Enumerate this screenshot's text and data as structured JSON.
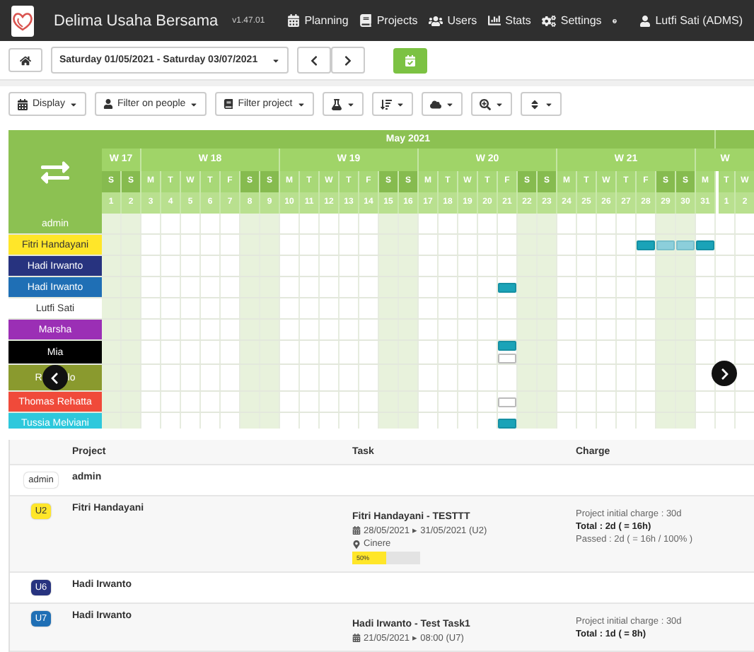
{
  "app": {
    "name": "Delima Usaha Bersama",
    "version": "v1.47.01",
    "menu": [
      {
        "kind": "planning",
        "label": "Planning"
      },
      {
        "kind": "projects",
        "label": "Projects"
      },
      {
        "kind": "users",
        "label": "Users"
      },
      {
        "kind": "stats",
        "label": "Stats"
      },
      {
        "kind": "settings",
        "label": "Settings"
      }
    ],
    "user": "Lutfi Sati (ADMS)"
  },
  "date_range": "Saturday 01/05/2021 - Saturday 03/07/2021",
  "filters": [
    {
      "kind": "display",
      "label": "Display"
    },
    {
      "kind": "people",
      "label": "Filter on people"
    },
    {
      "kind": "project",
      "label": "Filter project"
    },
    {
      "kind": "flask"
    },
    {
      "kind": "sort"
    },
    {
      "kind": "cloud"
    },
    {
      "kind": "zoom"
    },
    {
      "kind": "updown"
    }
  ],
  "months": [
    "May 2021"
  ],
  "weeks": [
    {
      "label": "W 17",
      "days": [
        {
          "n": "1",
          "d": "S",
          "weekend": true
        },
        {
          "n": "2",
          "d": "S",
          "weekend": true
        }
      ]
    },
    {
      "label": "W 18",
      "days": [
        {
          "n": "3",
          "d": "M",
          "weekend": false
        },
        {
          "n": "4",
          "d": "T",
          "weekend": false
        },
        {
          "n": "5",
          "d": "W",
          "weekend": false
        },
        {
          "n": "6",
          "d": "T",
          "weekend": false
        },
        {
          "n": "7",
          "d": "F",
          "weekend": false
        },
        {
          "n": "8",
          "d": "S",
          "weekend": true
        },
        {
          "n": "9",
          "d": "S",
          "weekend": true
        }
      ]
    },
    {
      "label": "W 19",
      "days": [
        {
          "n": "10",
          "d": "M",
          "weekend": false
        },
        {
          "n": "11",
          "d": "T",
          "weekend": false
        },
        {
          "n": "12",
          "d": "W",
          "weekend": false
        },
        {
          "n": "13",
          "d": "T",
          "weekend": false
        },
        {
          "n": "14",
          "d": "F",
          "weekend": false
        },
        {
          "n": "15",
          "d": "S",
          "weekend": true
        },
        {
          "n": "16",
          "d": "S",
          "weekend": true
        }
      ]
    },
    {
      "label": "W 20",
      "days": [
        {
          "n": "17",
          "d": "M",
          "weekend": false
        },
        {
          "n": "18",
          "d": "T",
          "weekend": false
        },
        {
          "n": "19",
          "d": "W",
          "weekend": false
        },
        {
          "n": "20",
          "d": "T",
          "weekend": false
        },
        {
          "n": "21",
          "d": "F",
          "weekend": false
        },
        {
          "n": "22",
          "d": "S",
          "weekend": true
        },
        {
          "n": "23",
          "d": "S",
          "weekend": true
        }
      ]
    },
    {
      "label": "W 21",
      "days": [
        {
          "n": "24",
          "d": "M",
          "weekend": false
        },
        {
          "n": "25",
          "d": "T",
          "weekend": false
        },
        {
          "n": "26",
          "d": "W",
          "weekend": false
        },
        {
          "n": "27",
          "d": "T",
          "weekend": false
        },
        {
          "n": "28",
          "d": "F",
          "weekend": false
        },
        {
          "n": "29",
          "d": "S",
          "weekend": true
        },
        {
          "n": "30",
          "d": "S",
          "weekend": true
        }
      ]
    },
    {
      "label": "W",
      "days": [
        {
          "n": "31",
          "d": "M",
          "weekend": false
        },
        {
          "n": "1",
          "d": "T",
          "weekend": false,
          "month_start": true
        },
        {
          "n": "2",
          "d": "W",
          "weekend": false
        }
      ]
    }
  ],
  "people": [
    {
      "name": "admin",
      "color": "#8cc152"
    },
    {
      "name": "Fitri Handayani",
      "color": "#ffe629",
      "cells": [
        {
          "kind": "empty"
        },
        {
          "kind": "empty"
        },
        {
          "kind": "empty"
        },
        {
          "kind": "empty"
        },
        {
          "kind": "empty"
        },
        {
          "kind": "empty"
        },
        {
          "kind": "empty"
        },
        {
          "kind": "empty"
        },
        {
          "kind": "empty"
        },
        {
          "kind": "empty"
        },
        {
          "kind": "empty"
        },
        {
          "kind": "empty"
        },
        {
          "kind": "empty"
        },
        {
          "kind": "empty"
        },
        {
          "kind": "empty"
        },
        {
          "kind": "empty"
        },
        {
          "kind": "empty"
        },
        {
          "kind": "empty"
        },
        {
          "kind": "empty"
        },
        {
          "kind": "empty"
        },
        {
          "kind": "empty"
        },
        {
          "kind": "empty"
        },
        {
          "kind": "empty"
        },
        {
          "kind": "empty"
        },
        {
          "kind": "empty"
        },
        {
          "kind": "empty"
        },
        {
          "kind": "empty"
        },
        {
          "kind": "bar"
        },
        {
          "kind": "faded-bar"
        },
        {
          "kind": "faded-bar"
        },
        {
          "kind": "bar"
        },
        {
          "kind": "empty"
        },
        {
          "kind": "empty"
        }
      ]
    },
    {
      "name": "Hadi Irwanto",
      "color": "#27337f"
    },
    {
      "name": "Hadi Irwanto",
      "color": "#1f6fb5",
      "cells": [
        {
          "kind": "empty"
        },
        {
          "kind": "empty"
        },
        {
          "kind": "empty"
        },
        {
          "kind": "empty"
        },
        {
          "kind": "empty"
        },
        {
          "kind": "empty"
        },
        {
          "kind": "empty"
        },
        {
          "kind": "empty"
        },
        {
          "kind": "empty"
        },
        {
          "kind": "empty"
        },
        {
          "kind": "empty"
        },
        {
          "kind": "empty"
        },
        {
          "kind": "empty"
        },
        {
          "kind": "empty"
        },
        {
          "kind": "empty"
        },
        {
          "kind": "empty"
        },
        {
          "kind": "empty"
        },
        {
          "kind": "empty"
        },
        {
          "kind": "empty"
        },
        {
          "kind": "empty"
        },
        {
          "kind": "bar"
        },
        {
          "kind": "empty"
        },
        {
          "kind": "empty"
        },
        {
          "kind": "empty"
        },
        {
          "kind": "empty"
        },
        {
          "kind": "empty"
        },
        {
          "kind": "empty"
        },
        {
          "kind": "empty"
        },
        {
          "kind": "empty"
        },
        {
          "kind": "empty"
        },
        {
          "kind": "empty"
        },
        {
          "kind": "empty"
        },
        {
          "kind": "empty"
        }
      ]
    },
    {
      "name": "Lutfi Sati",
      "color": "#ffffff"
    },
    {
      "name": "Marsha",
      "color": "#9b2fb5"
    },
    {
      "name": "Mia",
      "color": "#000000",
      "cells": [
        {
          "kind": "empty"
        },
        {
          "kind": "empty"
        },
        {
          "kind": "empty"
        },
        {
          "kind": "empty"
        },
        {
          "kind": "empty"
        },
        {
          "kind": "empty"
        },
        {
          "kind": "empty"
        },
        {
          "kind": "empty"
        },
        {
          "kind": "empty"
        },
        {
          "kind": "empty"
        },
        {
          "kind": "empty"
        },
        {
          "kind": "empty"
        },
        {
          "kind": "empty"
        },
        {
          "kind": "empty"
        },
        {
          "kind": "empty"
        },
        {
          "kind": "empty"
        },
        {
          "kind": "empty"
        },
        {
          "kind": "empty"
        },
        {
          "kind": "empty"
        },
        {
          "kind": "empty"
        },
        {
          "kind": "bar-note"
        },
        {
          "kind": "empty"
        },
        {
          "kind": "empty"
        },
        {
          "kind": "empty"
        },
        {
          "kind": "empty"
        },
        {
          "kind": "empty"
        },
        {
          "kind": "empty"
        },
        {
          "kind": "empty"
        },
        {
          "kind": "empty"
        },
        {
          "kind": "empty"
        },
        {
          "kind": "empty"
        },
        {
          "kind": "empty"
        },
        {
          "kind": "empty"
        }
      ]
    },
    {
      "name_parts": [
        "R",
        "lo"
      ],
      "color": "#8a9a2e"
    },
    {
      "name": "Thomas Rehatta",
      "color": "#f04a3a",
      "cells": [
        {
          "kind": "empty"
        },
        {
          "kind": "empty"
        },
        {
          "kind": "empty"
        },
        {
          "kind": "empty"
        },
        {
          "kind": "empty"
        },
        {
          "kind": "empty"
        },
        {
          "kind": "empty"
        },
        {
          "kind": "empty"
        },
        {
          "kind": "empty"
        },
        {
          "kind": "empty"
        },
        {
          "kind": "empty"
        },
        {
          "kind": "empty"
        },
        {
          "kind": "empty"
        },
        {
          "kind": "empty"
        },
        {
          "kind": "empty"
        },
        {
          "kind": "empty"
        },
        {
          "kind": "empty"
        },
        {
          "kind": "empty"
        },
        {
          "kind": "empty"
        },
        {
          "kind": "empty"
        },
        {
          "kind": "note"
        },
        {
          "kind": "empty"
        },
        {
          "kind": "empty"
        },
        {
          "kind": "empty"
        },
        {
          "kind": "empty"
        },
        {
          "kind": "empty"
        },
        {
          "kind": "empty"
        },
        {
          "kind": "empty"
        },
        {
          "kind": "empty"
        },
        {
          "kind": "empty"
        },
        {
          "kind": "empty"
        },
        {
          "kind": "empty"
        },
        {
          "kind": "empty"
        }
      ]
    },
    {
      "name": "Tussia Melviani",
      "color": "#2ec8dc",
      "cells": [
        {
          "kind": "empty"
        },
        {
          "kind": "empty"
        },
        {
          "kind": "empty"
        },
        {
          "kind": "empty"
        },
        {
          "kind": "empty"
        },
        {
          "kind": "empty"
        },
        {
          "kind": "empty"
        },
        {
          "kind": "empty"
        },
        {
          "kind": "empty"
        },
        {
          "kind": "empty"
        },
        {
          "kind": "empty"
        },
        {
          "kind": "empty"
        },
        {
          "kind": "empty"
        },
        {
          "kind": "empty"
        },
        {
          "kind": "empty"
        },
        {
          "kind": "empty"
        },
        {
          "kind": "empty"
        },
        {
          "kind": "empty"
        },
        {
          "kind": "empty"
        },
        {
          "kind": "empty"
        },
        {
          "kind": "bar"
        },
        {
          "kind": "empty"
        },
        {
          "kind": "empty"
        },
        {
          "kind": "empty"
        },
        {
          "kind": "empty"
        },
        {
          "kind": "empty"
        },
        {
          "kind": "empty"
        },
        {
          "kind": "empty"
        },
        {
          "kind": "empty"
        },
        {
          "kind": "empty"
        },
        {
          "kind": "empty"
        },
        {
          "kind": "empty"
        },
        {
          "kind": "empty"
        }
      ]
    }
  ],
  "table": {
    "columns": [
      "Project",
      "Task",
      "Charge"
    ],
    "rows": [
      {
        "badge": "admin",
        "color": "#ffffff",
        "project": "admin"
      },
      {
        "badge": "U2",
        "color": "#ffe629",
        "project": "Fitri Handayani",
        "task": {
          "title": "Fitri Handayani - TESTTT",
          "dates": "28/05/2021 ▸ 31/05/2021 (U2)",
          "place": "Cinere",
          "progress": "50%",
          "level": 0.5
        },
        "charge": [
          "Project initial charge : 30d",
          "Total : 2d ( = 16h)",
          "Passed : 2d ( = 16h / 100% )"
        ]
      },
      {
        "badge": "U6",
        "color": "#27337f",
        "project": "Hadi Irwanto"
      },
      {
        "badge": "U7",
        "color": "#1f6fb5",
        "project": "Hadi Irwanto",
        "task": {
          "title": "Hadi Irwanto - Test Task1",
          "dates": "21/05/2021 ▸ 08:00 (U7)"
        },
        "charge": [
          "Project initial charge : 30d",
          "Total : 1d ( = 8h)"
        ]
      }
    ]
  }
}
